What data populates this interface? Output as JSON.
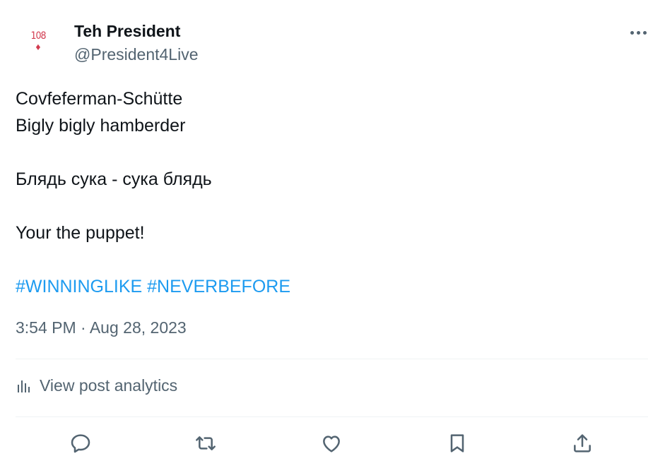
{
  "author": {
    "display_name": "Teh President",
    "handle": "@President4Live",
    "avatar": {
      "rank_text": "108",
      "suit_glyph": "♦",
      "color": "#d23b4f"
    }
  },
  "tweet": {
    "lines": [
      "Covfeferman-Schütte",
      "Bigly bigly hamberder",
      "Блядь сука - сука блядь",
      "Your the puppet!"
    ],
    "hashtags": [
      "#WINNINGLIKE",
      "#NEVERBEFORE"
    ],
    "time": "3:54 PM",
    "separator": "·",
    "date": "Aug 28, 2023"
  },
  "analytics": {
    "label": "View post analytics"
  },
  "actions": [
    {
      "name": "reply",
      "icon": "reply-icon"
    },
    {
      "name": "retweet",
      "icon": "retweet-icon"
    },
    {
      "name": "like",
      "icon": "heart-icon"
    },
    {
      "name": "bookmark",
      "icon": "bookmark-icon"
    },
    {
      "name": "share",
      "icon": "share-icon"
    }
  ],
  "colors": {
    "text": "#0f1419",
    "secondary": "#536471",
    "link": "#1d9bf0",
    "divider": "#eff3f4"
  }
}
